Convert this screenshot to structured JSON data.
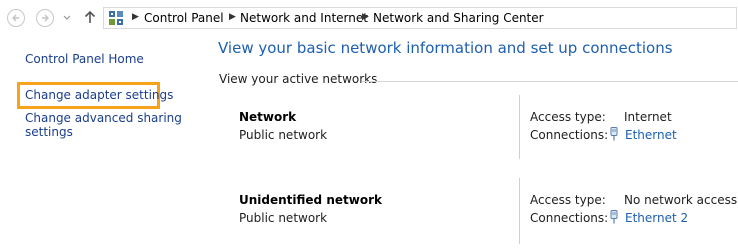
{
  "address_bar": {
    "breadcrumbs": [
      "Control Panel",
      "Network and Internet",
      "Network and Sharing Center"
    ]
  },
  "sidebar": {
    "home_label": "Control Panel Home",
    "links": [
      "Change adapter settings",
      "Change advanced sharing",
      "settings"
    ]
  },
  "main": {
    "title": "View your basic network information and set up connections",
    "active_networks_label": "View your active networks",
    "networks": [
      {
        "name": "Network",
        "category": "Public network",
        "access_type_label": "Access type:",
        "access_type_value": "Internet",
        "connections_label": "Connections:",
        "connection_name": "Ethernet"
      },
      {
        "name": "Unidentified network",
        "category": "Public network",
        "access_type_label": "Access type:",
        "access_type_value": "No network access",
        "connections_label": "Connections:",
        "connection_name": "Ethernet 2"
      }
    ]
  },
  "colors": {
    "focus_outline": "#f7a21b",
    "link": "#1d5fb0",
    "title": "#1d5fb0"
  }
}
